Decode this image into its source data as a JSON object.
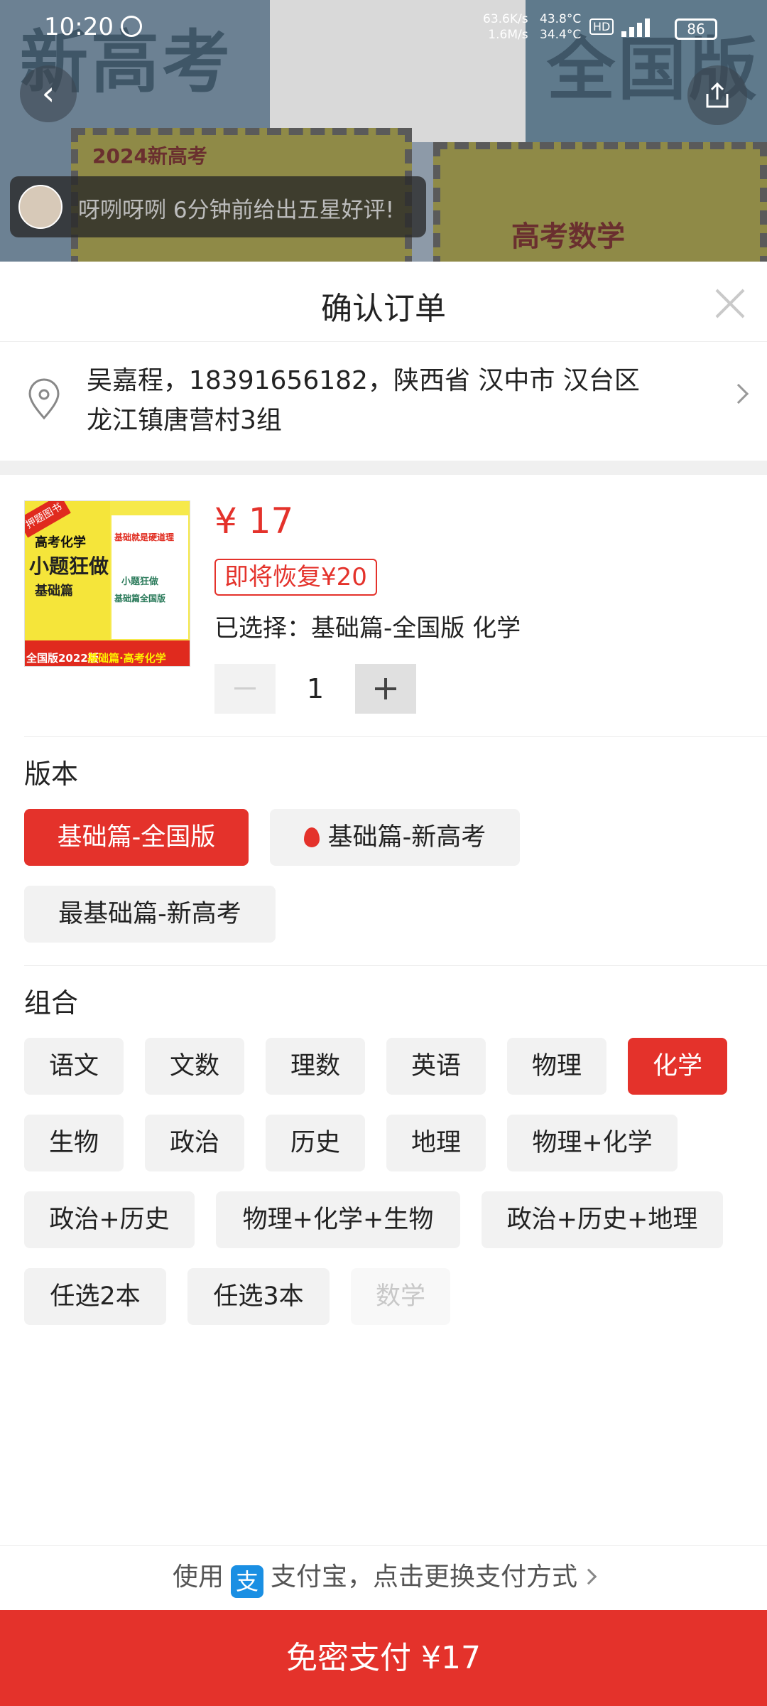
{
  "status_bar": {
    "time": "10:20",
    "net_up": "63.6K/s",
    "net_down": "1.6M/s",
    "temp1": "43.8°C",
    "temp2": "34.4°C",
    "hd": "HD",
    "battery": "86"
  },
  "background": {
    "title_left": "新高考",
    "title_right": "全国版",
    "book1_text": "2024新高考",
    "book2_text": "高考数学"
  },
  "toast": {
    "text": "呀咧呀咧 6分钟前给出五星好评!"
  },
  "sheet": {
    "title": "确认订单"
  },
  "address": {
    "line1": "吴嘉程，18391656182，陕西省 汉中市 汉台区",
    "line2": "龙江镇唐营村3组"
  },
  "product": {
    "image": {
      "badge": "押题图书",
      "t1": "高考化学",
      "t2": "小题狂做",
      "t3": "基础篇",
      "r1": "基础就是硬道理",
      "r2": "小题狂做",
      "r3": "基础篇全国版",
      "b1": "全国版2022版",
      "b2": "基础篇·高考化学"
    },
    "price": "¥ 17",
    "restore_tag": "即将恢复¥20",
    "selected_label": "已选择：",
    "selected_value": "基础篇-全国版 化学",
    "quantity": "1"
  },
  "version": {
    "title": "版本",
    "options": [
      "基础篇-全国版",
      "基础篇-新高考",
      "最基础篇-新高考"
    ],
    "selected_index": 0
  },
  "combo": {
    "title": "组合",
    "options": [
      "语文",
      "文数",
      "理数",
      "英语",
      "物理",
      "化学",
      "生物",
      "政治",
      "历史",
      "地理",
      "物理+化学",
      "政治+历史",
      "物理+化学+生物",
      "政治+历史+地理",
      "任选2本",
      "任选3本",
      "数学"
    ],
    "selected": "化学",
    "disabled": "数学"
  },
  "payment": {
    "prefix": "使用",
    "logo": "支",
    "suffix": "支付宝，点击更换支付方式",
    "button": "免密支付 ¥17"
  },
  "colors": {
    "accent": "#e4322b",
    "alipay": "#1a8fe3"
  }
}
